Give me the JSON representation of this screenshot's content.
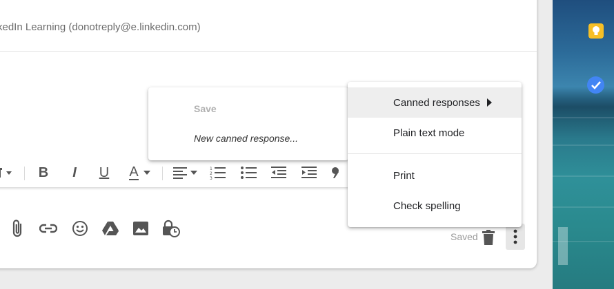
{
  "compose": {
    "from_text": "kedIn Learning (donotreply@e.linkedin.com)"
  },
  "format_toolbar": {
    "items": [
      "font-size",
      "bold",
      "italic",
      "underline",
      "text-color",
      "align",
      "numbered-list",
      "bulleted-list",
      "indent-less",
      "indent-more",
      "quote"
    ],
    "bold_glyph": "B",
    "italic_glyph": "I",
    "underline_glyph": "U",
    "text_color_glyph": "A"
  },
  "bottom_bar": {
    "icons": [
      "paperclip-icon",
      "link-icon",
      "emoji-icon",
      "drive-icon",
      "photo-icon",
      "confidential-mode-icon"
    ],
    "saved_label": "Saved",
    "delete_icon": "trash-icon",
    "more_icon": "more-vert-icon"
  },
  "more_menu": {
    "items": [
      {
        "label": "Canned responses",
        "has_submenu": true,
        "highlighted": true
      },
      {
        "label": "Plain text mode"
      },
      {
        "label": "Print"
      },
      {
        "label": "Check spelling"
      }
    ]
  },
  "canned_submenu": {
    "save_label": "Save",
    "new_label": "New canned response..."
  },
  "colors": {
    "keep": "#f6bf26",
    "tasks": "#4285f4",
    "highlight": "#eeeeee"
  }
}
